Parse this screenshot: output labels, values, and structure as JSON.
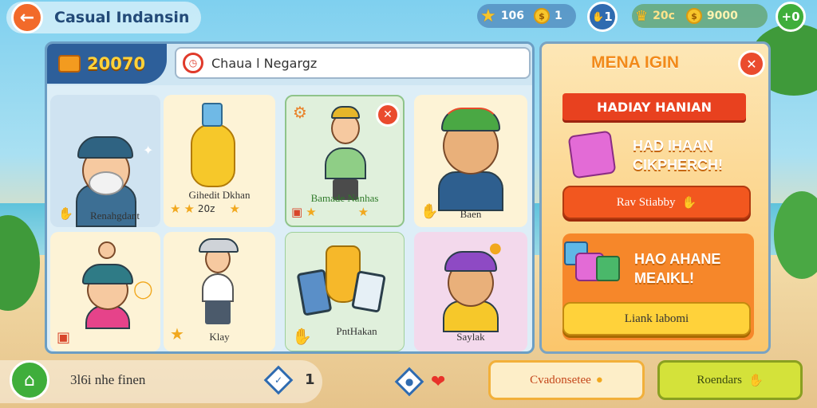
{
  "header": {
    "title": "Casual Indansin",
    "stars_count": "106",
    "coins_count": "1",
    "badge_value": "1",
    "wallet_left": "20c",
    "wallet_coins": "9000",
    "plus_label": "0"
  },
  "panel": {
    "score": "20070",
    "search_value": "Chaua l Negargz",
    "cards": [
      {
        "label": "Renahgdant"
      },
      {
        "label": "Gihedit Dkhan",
        "rating": "20z"
      },
      {
        "label": "Bamade Nanhas"
      },
      {
        "label": "Baen"
      },
      {
        "label": ""
      },
      {
        "label": "Klay"
      },
      {
        "label": "PntHakan"
      },
      {
        "label": "Saylak"
      }
    ]
  },
  "side": {
    "title": "MENA IGIN",
    "ribbon": "HADIAY HANIAN",
    "reward1_line1": "HAD IHAAN",
    "reward1_line2": "CIKPHERCH!",
    "reward1_button": "Rav Stiabby",
    "reward2_line1": "HAO AHANE",
    "reward2_line2": "MEAIKL!",
    "reward2_button": "Liank labomi"
  },
  "bottom": {
    "status_text": "3l6i nhe finen",
    "count": "1",
    "btn_left": "Cvadonsetee",
    "btn_right": "Roendars"
  },
  "colors": {
    "accent_orange": "#f26a2a",
    "panel_blue": "#2d5f9a",
    "green": "#3fae3b",
    "gold": "#ffd23a"
  }
}
